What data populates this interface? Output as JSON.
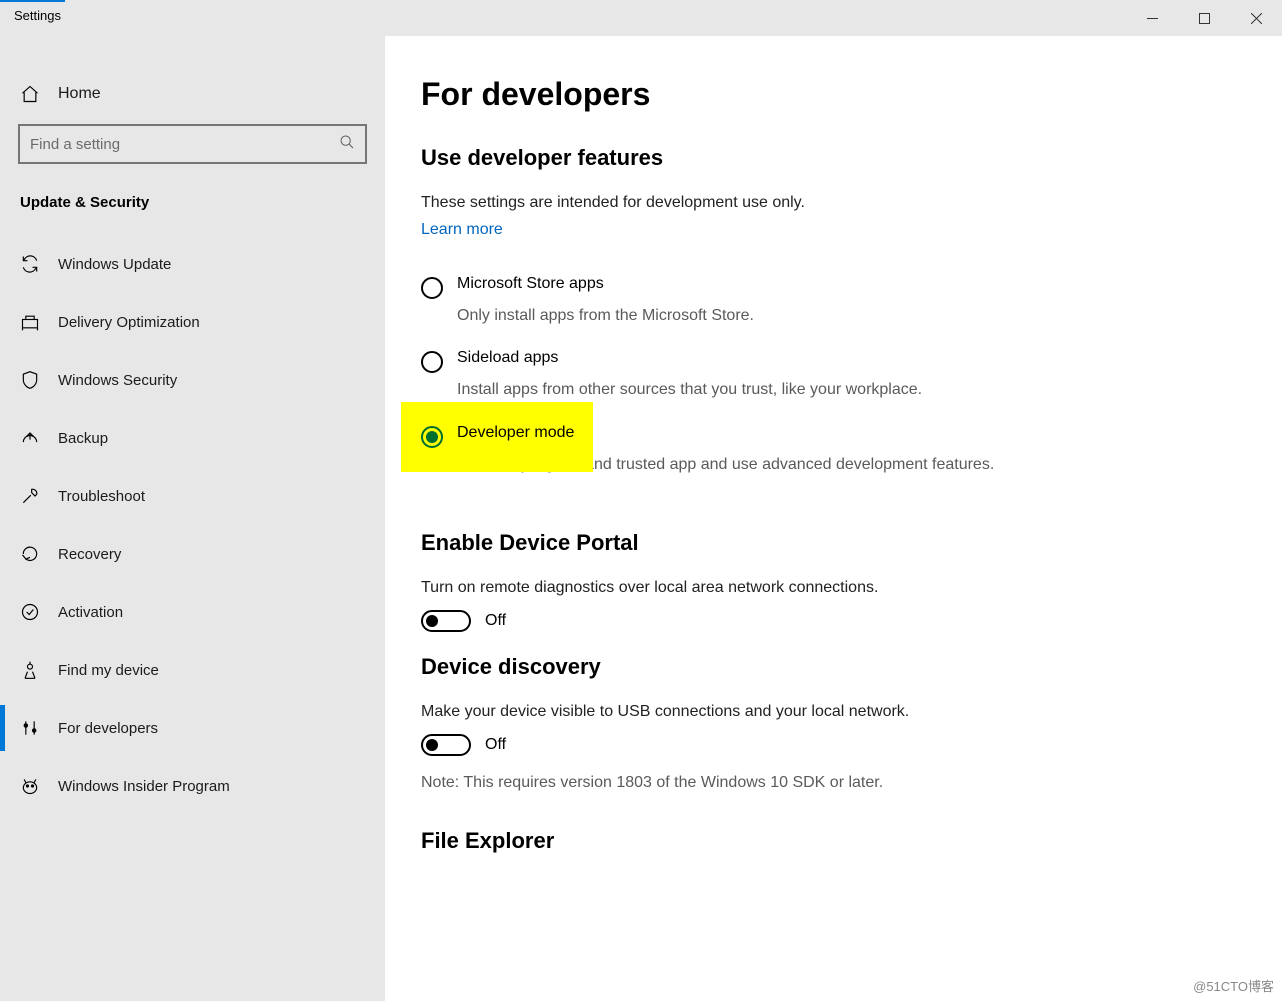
{
  "window": {
    "title": "Settings"
  },
  "sidebar": {
    "home": "Home",
    "search_placeholder": "Find a setting",
    "section": "Update & Security",
    "items": [
      {
        "id": "windows-update",
        "label": "Windows Update"
      },
      {
        "id": "delivery-optimization",
        "label": "Delivery Optimization"
      },
      {
        "id": "windows-security",
        "label": "Windows Security"
      },
      {
        "id": "backup",
        "label": "Backup"
      },
      {
        "id": "troubleshoot",
        "label": "Troubleshoot"
      },
      {
        "id": "recovery",
        "label": "Recovery"
      },
      {
        "id": "activation",
        "label": "Activation"
      },
      {
        "id": "find-my-device",
        "label": "Find my device"
      },
      {
        "id": "for-developers",
        "label": "For developers",
        "selected": true
      },
      {
        "id": "windows-insider",
        "label": "Windows Insider Program"
      }
    ]
  },
  "main": {
    "title": "For developers",
    "dev_features": {
      "heading": "Use developer features",
      "desc": "These settings are intended for development use only.",
      "learn_more": "Learn more",
      "options": [
        {
          "label": "Microsoft Store apps",
          "sub": "Only install apps from the Microsoft Store.",
          "selected": false
        },
        {
          "label": "Sideload apps",
          "sub": "Install apps from other sources that you trust, like your workplace.",
          "selected": false
        },
        {
          "label": "Developer mode",
          "sub": "Install any signed and trusted app and use advanced development features.",
          "selected": true,
          "highlighted": true
        }
      ]
    },
    "device_portal": {
      "heading": "Enable Device Portal",
      "desc": "Turn on remote diagnostics over local area network connections.",
      "toggle_state": "Off"
    },
    "device_discovery": {
      "heading": "Device discovery",
      "desc": "Make your device visible to USB connections and your local network.",
      "toggle_state": "Off",
      "note": "Note: This requires version 1803 of the Windows 10 SDK or later."
    },
    "file_explorer": {
      "heading": "File Explorer"
    }
  },
  "watermark": "@51CTO博客"
}
